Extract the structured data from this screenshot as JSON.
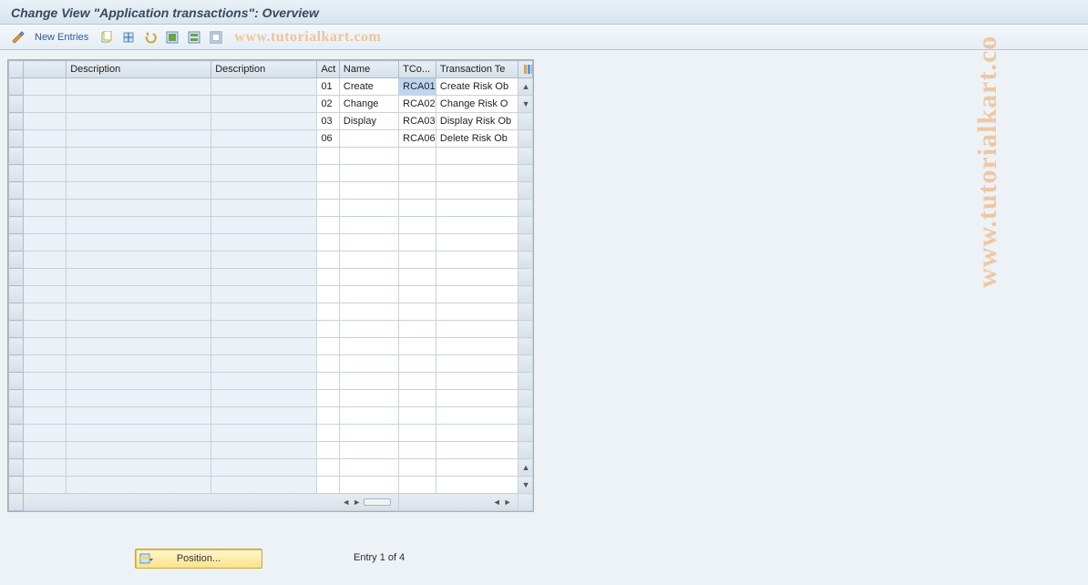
{
  "header": {
    "title": "Change View \"Application transactions\": Overview"
  },
  "toolbar": {
    "new_entries_label": "New Entries"
  },
  "watermark": {
    "top": "www.tutorialkart.com",
    "side": "www.tutorialkart.co"
  },
  "table": {
    "columns": {
      "blank": "",
      "desc1": "Description",
      "desc2": "Description",
      "act": "Act",
      "name": "Name",
      "tco": "TCo...",
      "tt": "Transaction Te"
    },
    "rows": [
      {
        "blank": "",
        "desc1": "",
        "desc2": "",
        "act": "01",
        "name": "Create",
        "tco": "RCA01",
        "tt": "Create Risk Ob"
      },
      {
        "blank": "",
        "desc1": "",
        "desc2": "",
        "act": "02",
        "name": "Change",
        "tco": "RCA02",
        "tt": "Change Risk O"
      },
      {
        "blank": "",
        "desc1": "",
        "desc2": "",
        "act": "03",
        "name": "Display",
        "tco": "RCA03",
        "tt": "Display Risk Ob"
      },
      {
        "blank": "",
        "desc1": "",
        "desc2": "",
        "act": "06",
        "name": "",
        "tco": "RCA06",
        "tt": "Delete Risk Ob"
      }
    ],
    "empty_rows": 20,
    "selected_cell": {
      "row_index": 0,
      "field": "tco"
    }
  },
  "footer": {
    "position_label": "Position...",
    "entry_text": "Entry 1 of 4"
  },
  "icons": {
    "pencil": "pencil-icon",
    "copy": "copy-icon",
    "save_variant": "save-variant-icon",
    "undo": "undo-icon",
    "select_all": "select-all-icon",
    "table_settings": "table-settings-icon",
    "deselect": "deselect-icon"
  }
}
